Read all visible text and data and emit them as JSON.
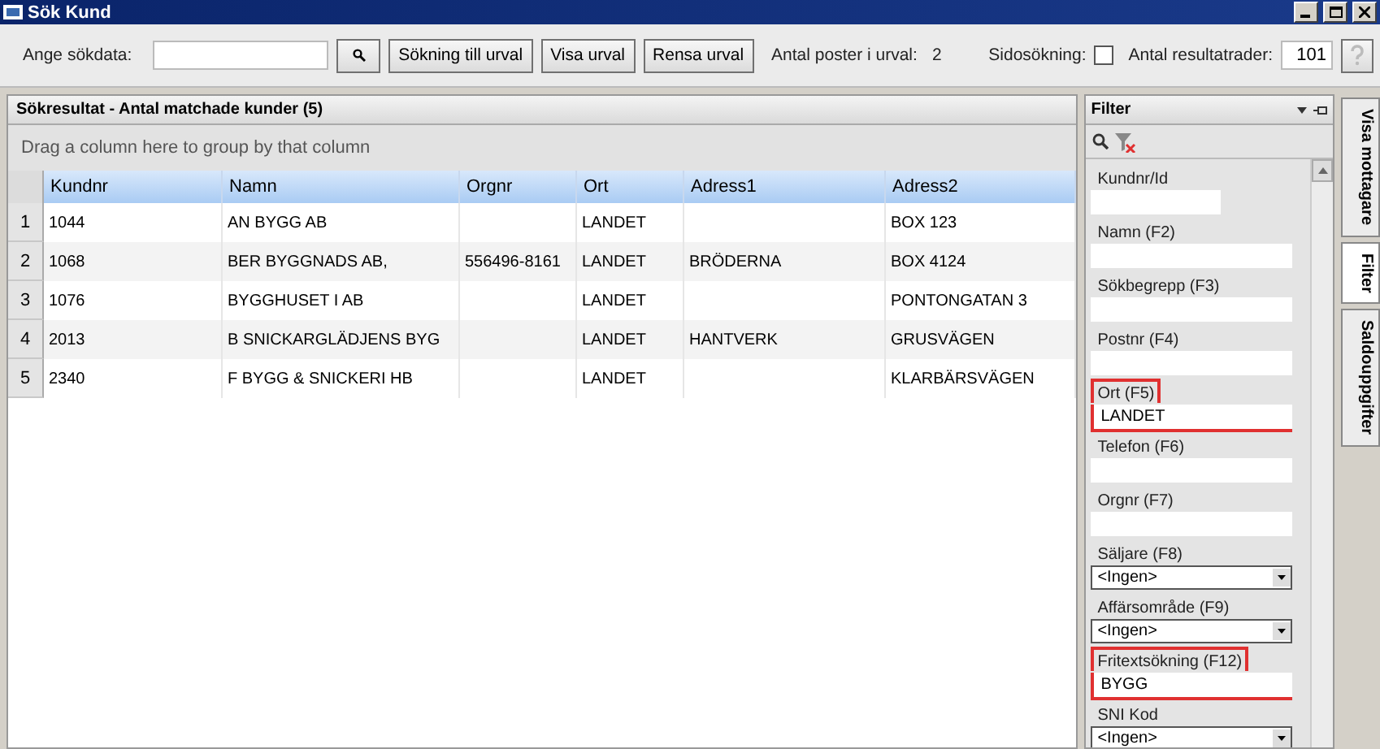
{
  "window": {
    "title": "Sök Kund"
  },
  "toolbar": {
    "search_label": "Ange sökdata:",
    "buttons": [
      "Sökning till urval",
      "Visa urval",
      "Rensa urval"
    ],
    "count_label": "Antal poster i urval:",
    "count_value": "2",
    "side_search_label": "Sidosökning:",
    "side_search_checked": false,
    "rows_label": "Antal resultatrader:",
    "rows_value": "101"
  },
  "results": {
    "title": "Sökresultat - Antal matchade kunder (5)",
    "group_hint": "Drag a column here to group by that column",
    "columns": [
      "Kundnr",
      "Namn",
      "Orgnr",
      "Ort",
      "Adress1",
      "Adress2"
    ],
    "rows": [
      {
        "number": "1",
        "cells": [
          "1044",
          "AN BYGG AB",
          "",
          "LANDET",
          "",
          "BOX 123"
        ]
      },
      {
        "number": "2",
        "cells": [
          "1068",
          "BER BYGGNADS AB,",
          "556496-8161",
          "LANDET",
          "BRÖDERNA",
          "BOX 4124"
        ]
      },
      {
        "number": "3",
        "cells": [
          "1076",
          "BYGGHUSET I AB",
          "",
          "LANDET",
          "",
          "PONTONGATAN 3"
        ]
      },
      {
        "number": "4",
        "cells": [
          "2013",
          "B SNICKARGLÄDJENS BYG",
          "",
          "LANDET",
          "HANTVERK",
          "GRUSVÄGEN"
        ]
      },
      {
        "number": "5",
        "cells": [
          "2340",
          "F BYGG & SNICKERI HB",
          "",
          "LANDET",
          "",
          "KLARBÄRSVÄGEN"
        ]
      }
    ]
  },
  "filter": {
    "title": "Filter",
    "fields": [
      {
        "kind": "text",
        "label": "Kundnr/Id",
        "short": true,
        "highlighted": false
      },
      {
        "kind": "text",
        "label": "Namn (F2)",
        "short": false,
        "highlighted": false
      },
      {
        "kind": "text",
        "label": "Sökbegrepp (F3)",
        "short": false,
        "highlighted": false
      },
      {
        "kind": "text",
        "label": "Postnr (F4)",
        "short": false,
        "highlighted": false
      },
      {
        "kind": "text",
        "label": "Ort (F5)",
        "value": "LANDET",
        "short": false,
        "highlighted": true
      },
      {
        "kind": "text",
        "label": "Telefon (F6)",
        "short": false,
        "highlighted": false
      },
      {
        "kind": "text",
        "label": "Orgnr (F7)",
        "short": false,
        "highlighted": false
      },
      {
        "kind": "select",
        "label": "Säljare (F8)",
        "value": "<Ingen>",
        "highlighted": false
      },
      {
        "kind": "select",
        "label": "Affärsområde (F9)",
        "value": "<Ingen>",
        "highlighted": false
      },
      {
        "kind": "text",
        "label": "Fritextsökning (F12)",
        "value": "BYGG",
        "short": false,
        "highlighted": true
      },
      {
        "kind": "select",
        "label": "SNI Kod",
        "value": "<Ingen>",
        "highlighted": false
      }
    ]
  },
  "side_tabs": [
    {
      "label": "Visa mottagare",
      "selected": false
    },
    {
      "label": "Filter",
      "selected": true
    },
    {
      "label": "Saldouppgifter",
      "selected": false
    }
  ]
}
